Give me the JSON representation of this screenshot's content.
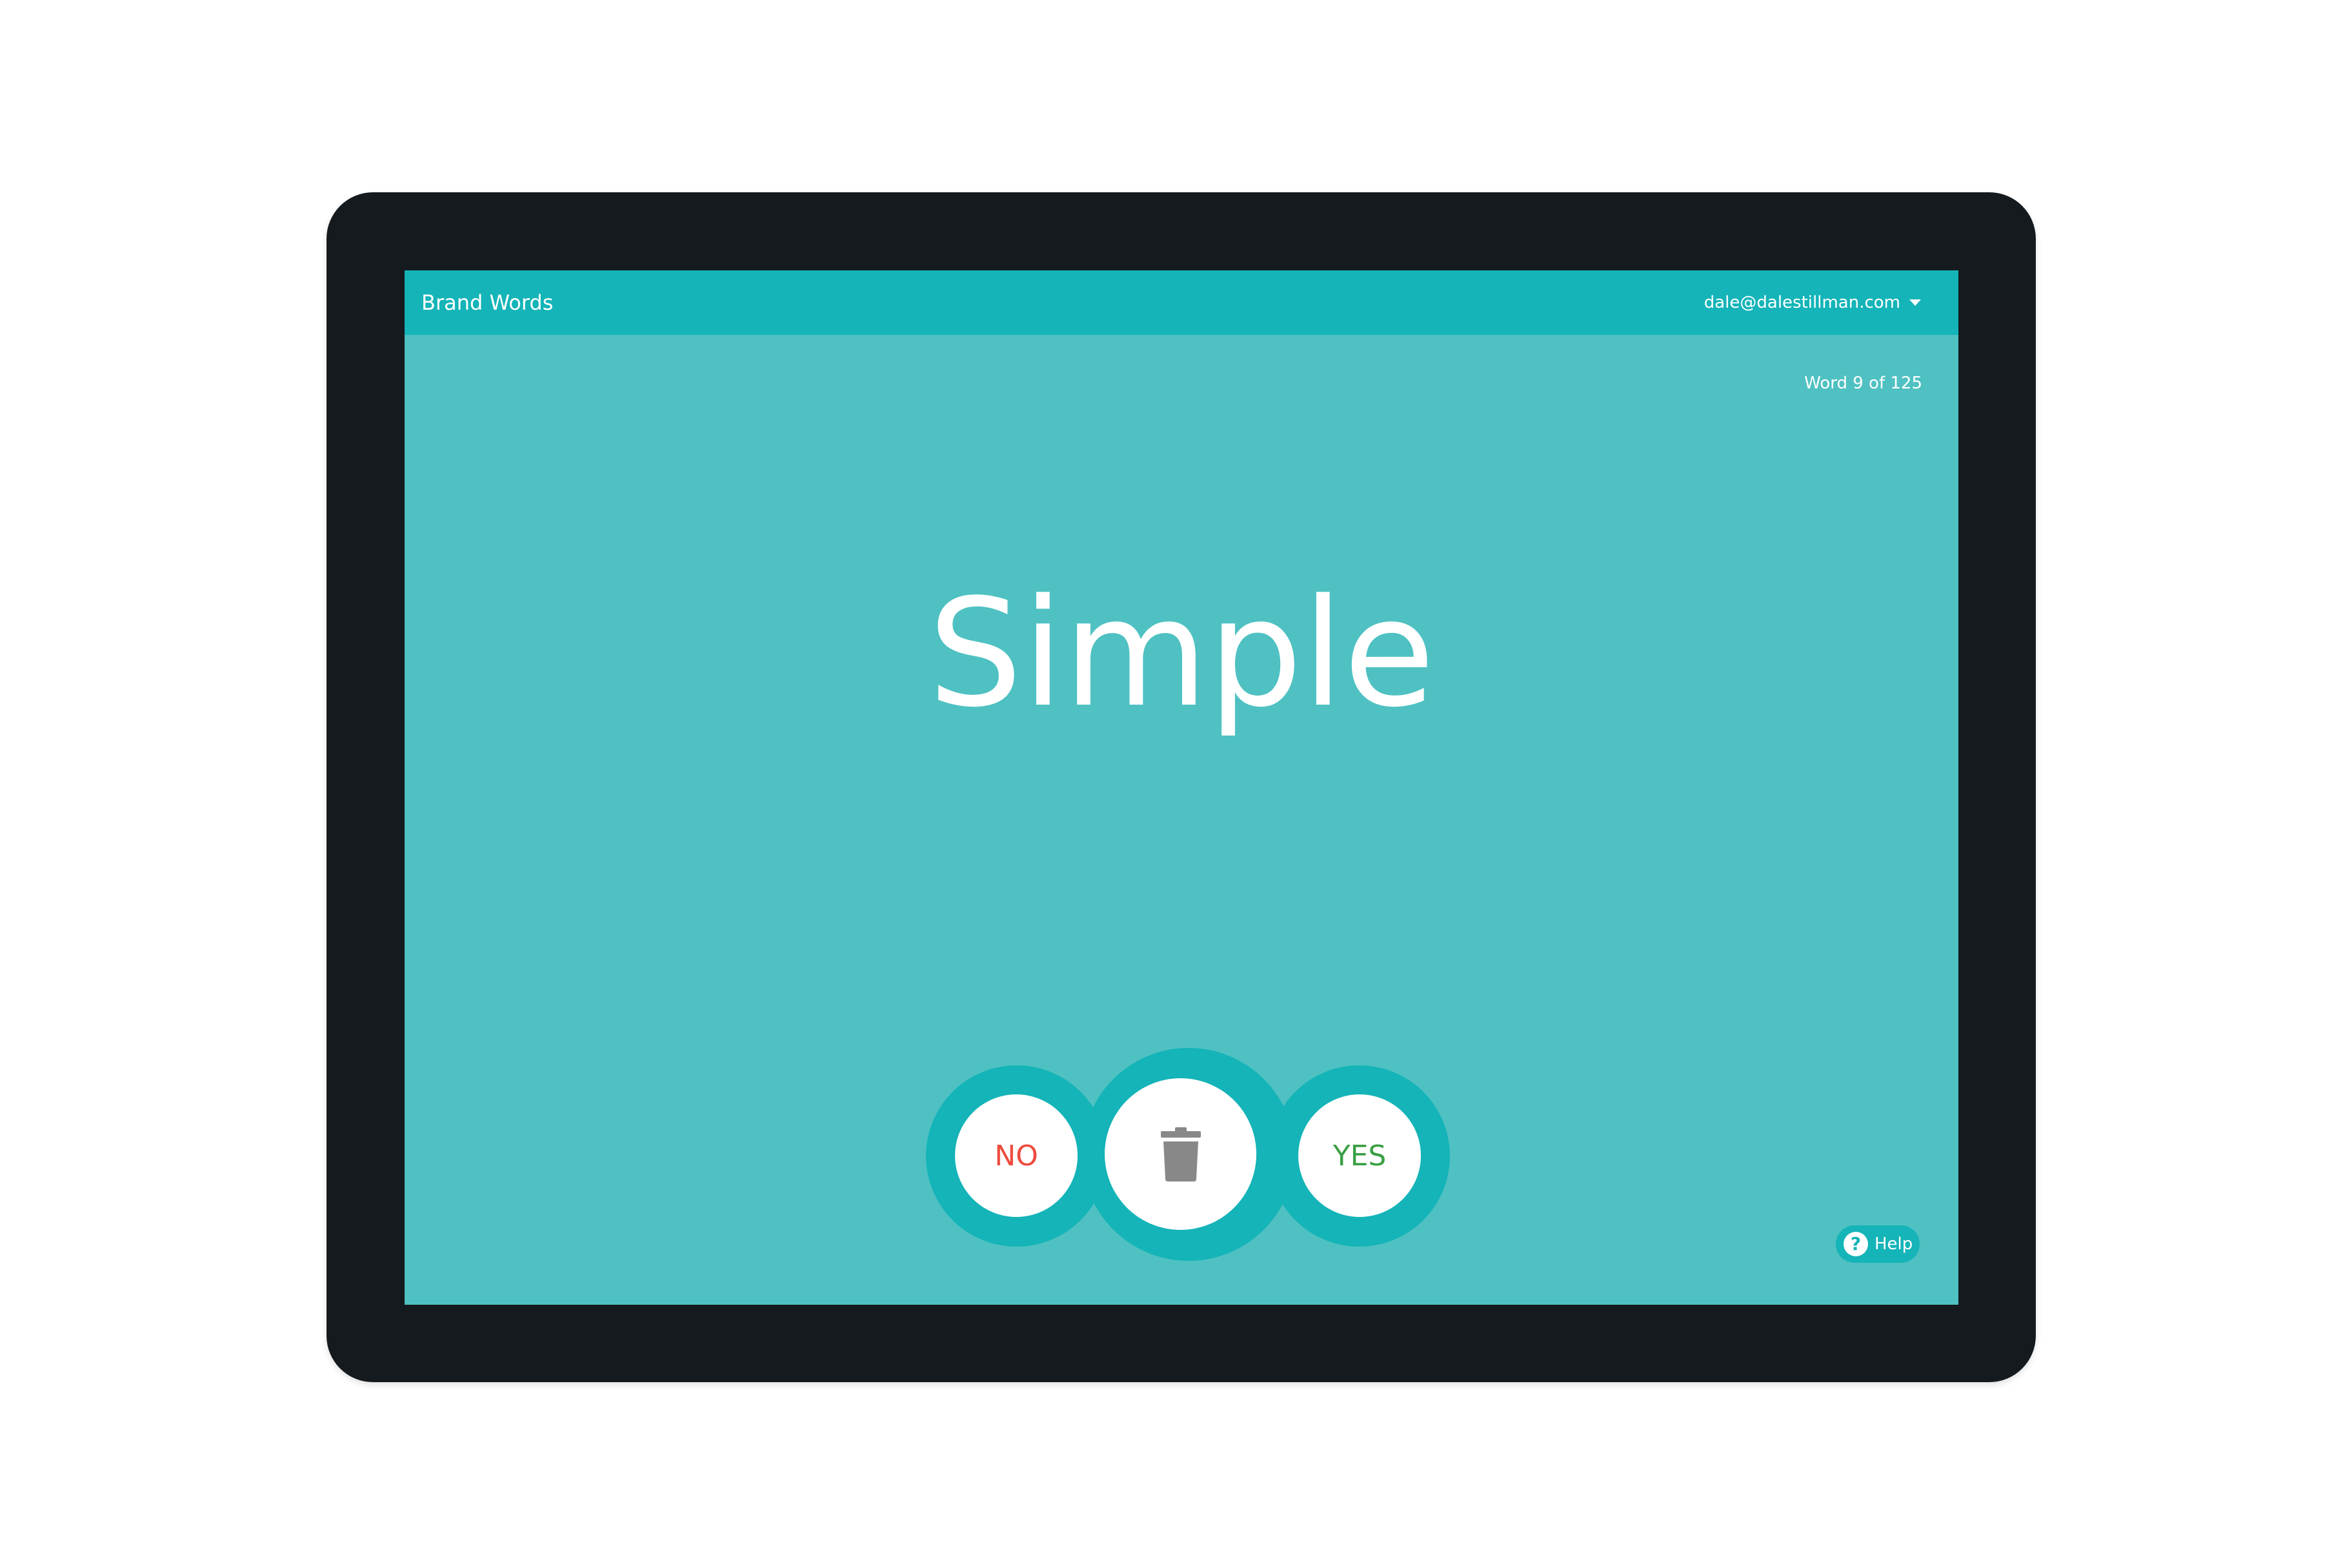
{
  "header": {
    "app_title": "Brand Words",
    "account_email": "dale@dalestillman.com",
    "account_menu_icon": "caret-down-icon"
  },
  "progress": {
    "label": "Word 9 of 125",
    "current": 9,
    "total": 125
  },
  "card": {
    "word": "Simple"
  },
  "actions": {
    "no_label": "NO",
    "yes_label": "YES",
    "delete_icon": "trash-icon"
  },
  "help": {
    "label": "Help",
    "icon": "question-icon",
    "icon_glyph": "?"
  },
  "colors": {
    "screen_background": "#4fc1c2",
    "header_background": "#14b4b8",
    "device_frame": "#151a1e",
    "no_color": "#ee4a3d",
    "yes_color": "#3a9f44",
    "trash_color": "#888888"
  }
}
